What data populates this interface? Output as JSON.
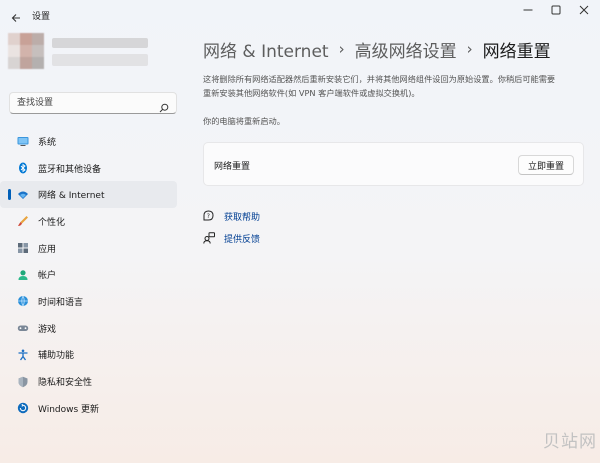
{
  "window": {
    "title": "设置",
    "controls": {
      "minimize_icon": "minimize-icon",
      "maximize_icon": "maximize-icon",
      "close_icon": "close-icon"
    }
  },
  "search": {
    "placeholder": "查找设置",
    "value": "",
    "icon": "search-icon"
  },
  "nav": {
    "items": [
      {
        "label": "系统",
        "icon": "system-icon",
        "active": false
      },
      {
        "label": "蓝牙和其他设备",
        "icon": "bluetooth-icon",
        "active": false
      },
      {
        "label": "网络 & Internet",
        "icon": "network-icon",
        "active": true
      },
      {
        "label": "个性化",
        "icon": "personalization-icon",
        "active": false
      },
      {
        "label": "应用",
        "icon": "apps-icon",
        "active": false
      },
      {
        "label": "帐户",
        "icon": "account-icon",
        "active": false
      },
      {
        "label": "时间和语言",
        "icon": "time-language-icon",
        "active": false
      },
      {
        "label": "游戏",
        "icon": "gaming-icon",
        "active": false
      },
      {
        "label": "辅助功能",
        "icon": "accessibility-icon",
        "active": false
      },
      {
        "label": "隐私和安全性",
        "icon": "privacy-icon",
        "active": false
      },
      {
        "label": "Windows 更新",
        "icon": "windows-update-icon",
        "active": false
      }
    ]
  },
  "breadcrumb": {
    "items": [
      "网络 & Internet",
      "高级网络设置",
      "网络重置"
    ],
    "separator": "›"
  },
  "main": {
    "description_line1": "这将删除所有网络适配器然后重新安装它们，并将其他网络组件设回为原始设置。你稍后可能需要",
    "description_line2": "重新安装其他网络软件(如 VPN 客户端软件或虚拟交换机)。",
    "notice": "你的电脑将重新启动。",
    "card": {
      "label": "网络重置",
      "button_label": "立即重置"
    },
    "links": [
      {
        "label": "获取帮助",
        "icon": "help-icon"
      },
      {
        "label": "提供反馈",
        "icon": "feedback-icon"
      }
    ]
  },
  "watermark": "贝站网",
  "colors": {
    "accent": "#005fb8",
    "link": "#003e92"
  }
}
